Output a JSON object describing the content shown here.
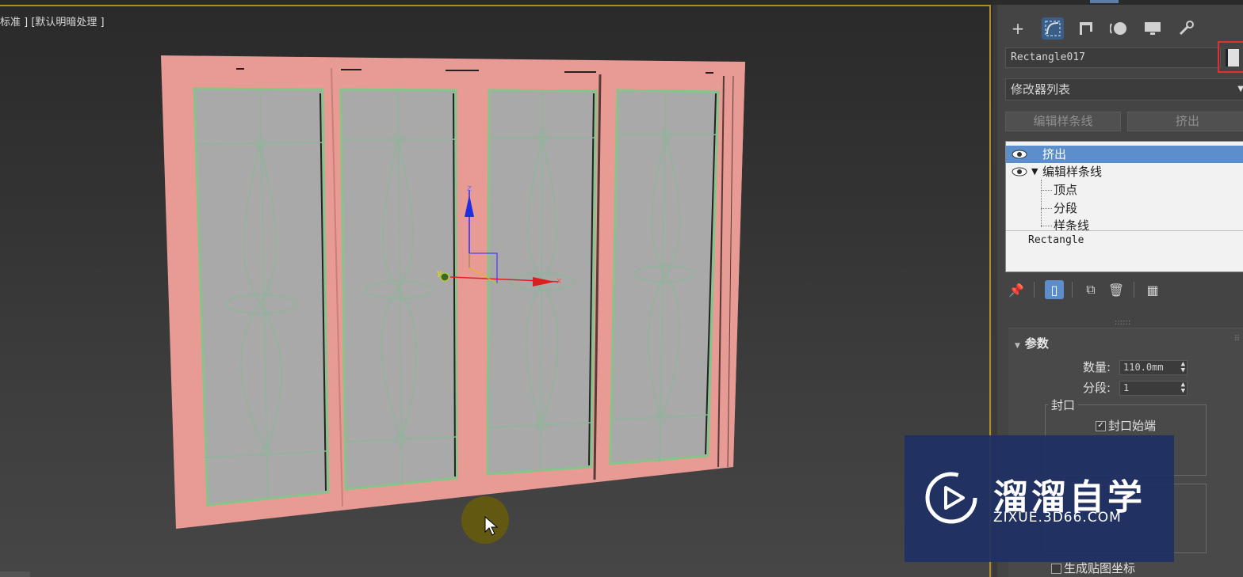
{
  "viewport": {
    "label": "标准 ] [默认明暗处理 ]",
    "gizmo_axes": {
      "z": "z",
      "x": "x",
      "y": "y"
    }
  },
  "panel": {
    "tabs": [
      {
        "name": "create-icon",
        "glyph": "+"
      },
      {
        "name": "modify-icon",
        "glyph": "⌒"
      },
      {
        "name": "hierarchy-icon",
        "glyph": "⊓"
      },
      {
        "name": "motion-icon",
        "glyph": "●"
      },
      {
        "name": "display-icon",
        "glyph": "▭"
      },
      {
        "name": "utilities-icon",
        "glyph": "🔧"
      }
    ],
    "object_name": "Rectangle017",
    "modifier_list": "修改器列表",
    "buttons": {
      "edit_spline": "编辑样条线",
      "extrude": "挤出"
    },
    "stack": {
      "extrude": "挤出",
      "edit_spline": "编辑样条线",
      "vertex": "顶点",
      "segment": "分段",
      "spline": "样条线",
      "rectangle": "Rectangle"
    },
    "parameters": {
      "title": "参数",
      "amount_label": "数量:",
      "amount_value": "110.0mm",
      "segments_label": "分段:",
      "segments_value": "1",
      "cap_label": "封口",
      "cap_start": "封口始端",
      "map_coords": "生成贴图坐标"
    }
  },
  "watermark": {
    "title": "溜溜自学",
    "url": "ZIXUE.3D66.COM"
  }
}
